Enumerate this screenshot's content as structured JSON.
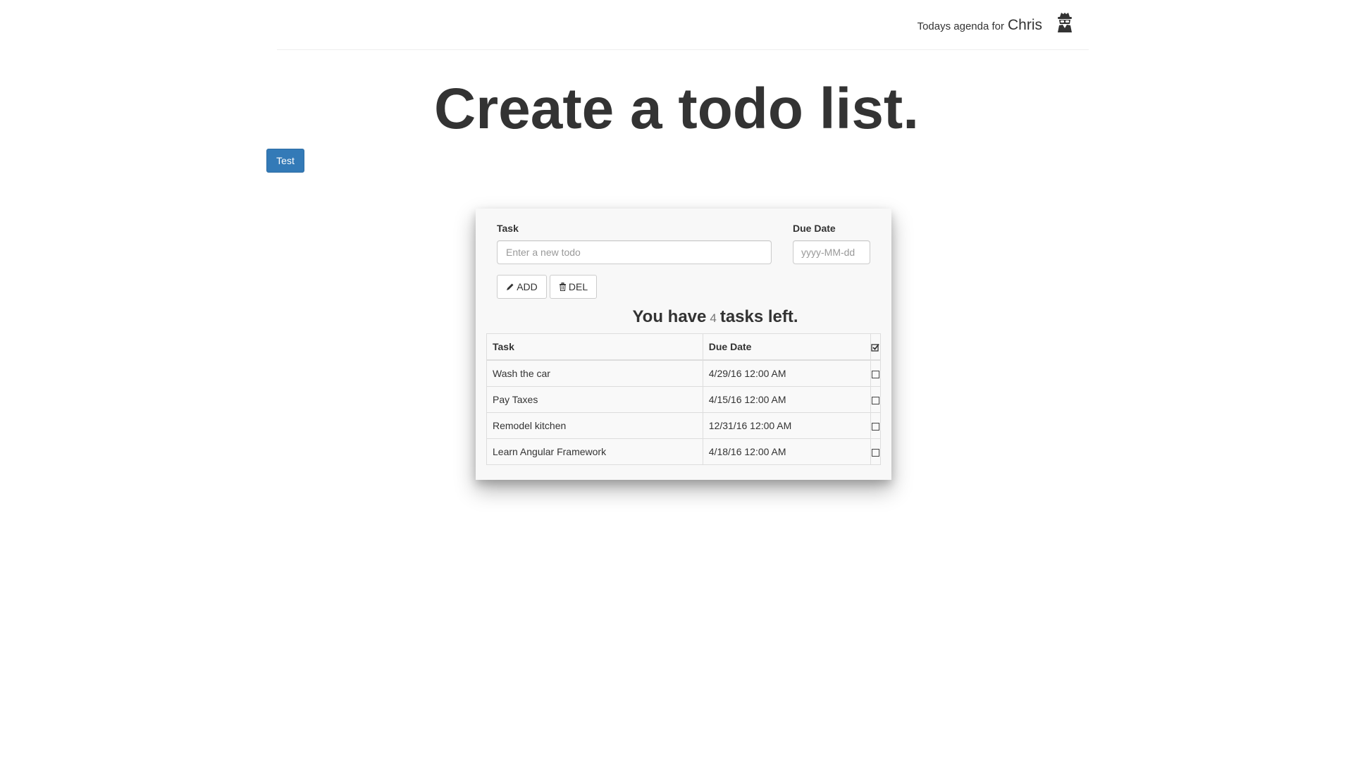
{
  "header": {
    "agenda_prefix": "Todays agenda for",
    "user_name": "Chris",
    "user_icon": "spy-agent-icon"
  },
  "main": {
    "title": "Create a todo list.",
    "test_button_label": "Test"
  },
  "form": {
    "task_label": "Task",
    "task_placeholder": "Enter a new todo",
    "due_label": "Due Date",
    "due_placeholder": "yyyy-MM-dd",
    "add_label": "ADD",
    "add_icon": "pencil-icon",
    "del_label": "DEL",
    "del_icon": "trash-icon"
  },
  "summary": {
    "prefix": "You have",
    "count": "4",
    "suffix": "tasks left."
  },
  "table": {
    "headers": {
      "task": "Task",
      "due": "Due Date",
      "done_icon": "check-square-icon"
    },
    "rows": [
      {
        "task": "Wash the car",
        "due": "4/29/16 12:00 AM"
      },
      {
        "task": "Pay Taxes",
        "due": "4/15/16 12:00 AM"
      },
      {
        "task": "Remodel kitchen",
        "due": "12/31/16 12:00 AM"
      },
      {
        "task": "Learn Angular Framework",
        "due": "4/18/16 12:00 AM"
      }
    ]
  },
  "colors": {
    "primary": "#337ab7",
    "text": "#333333",
    "muted": "#777777"
  }
}
